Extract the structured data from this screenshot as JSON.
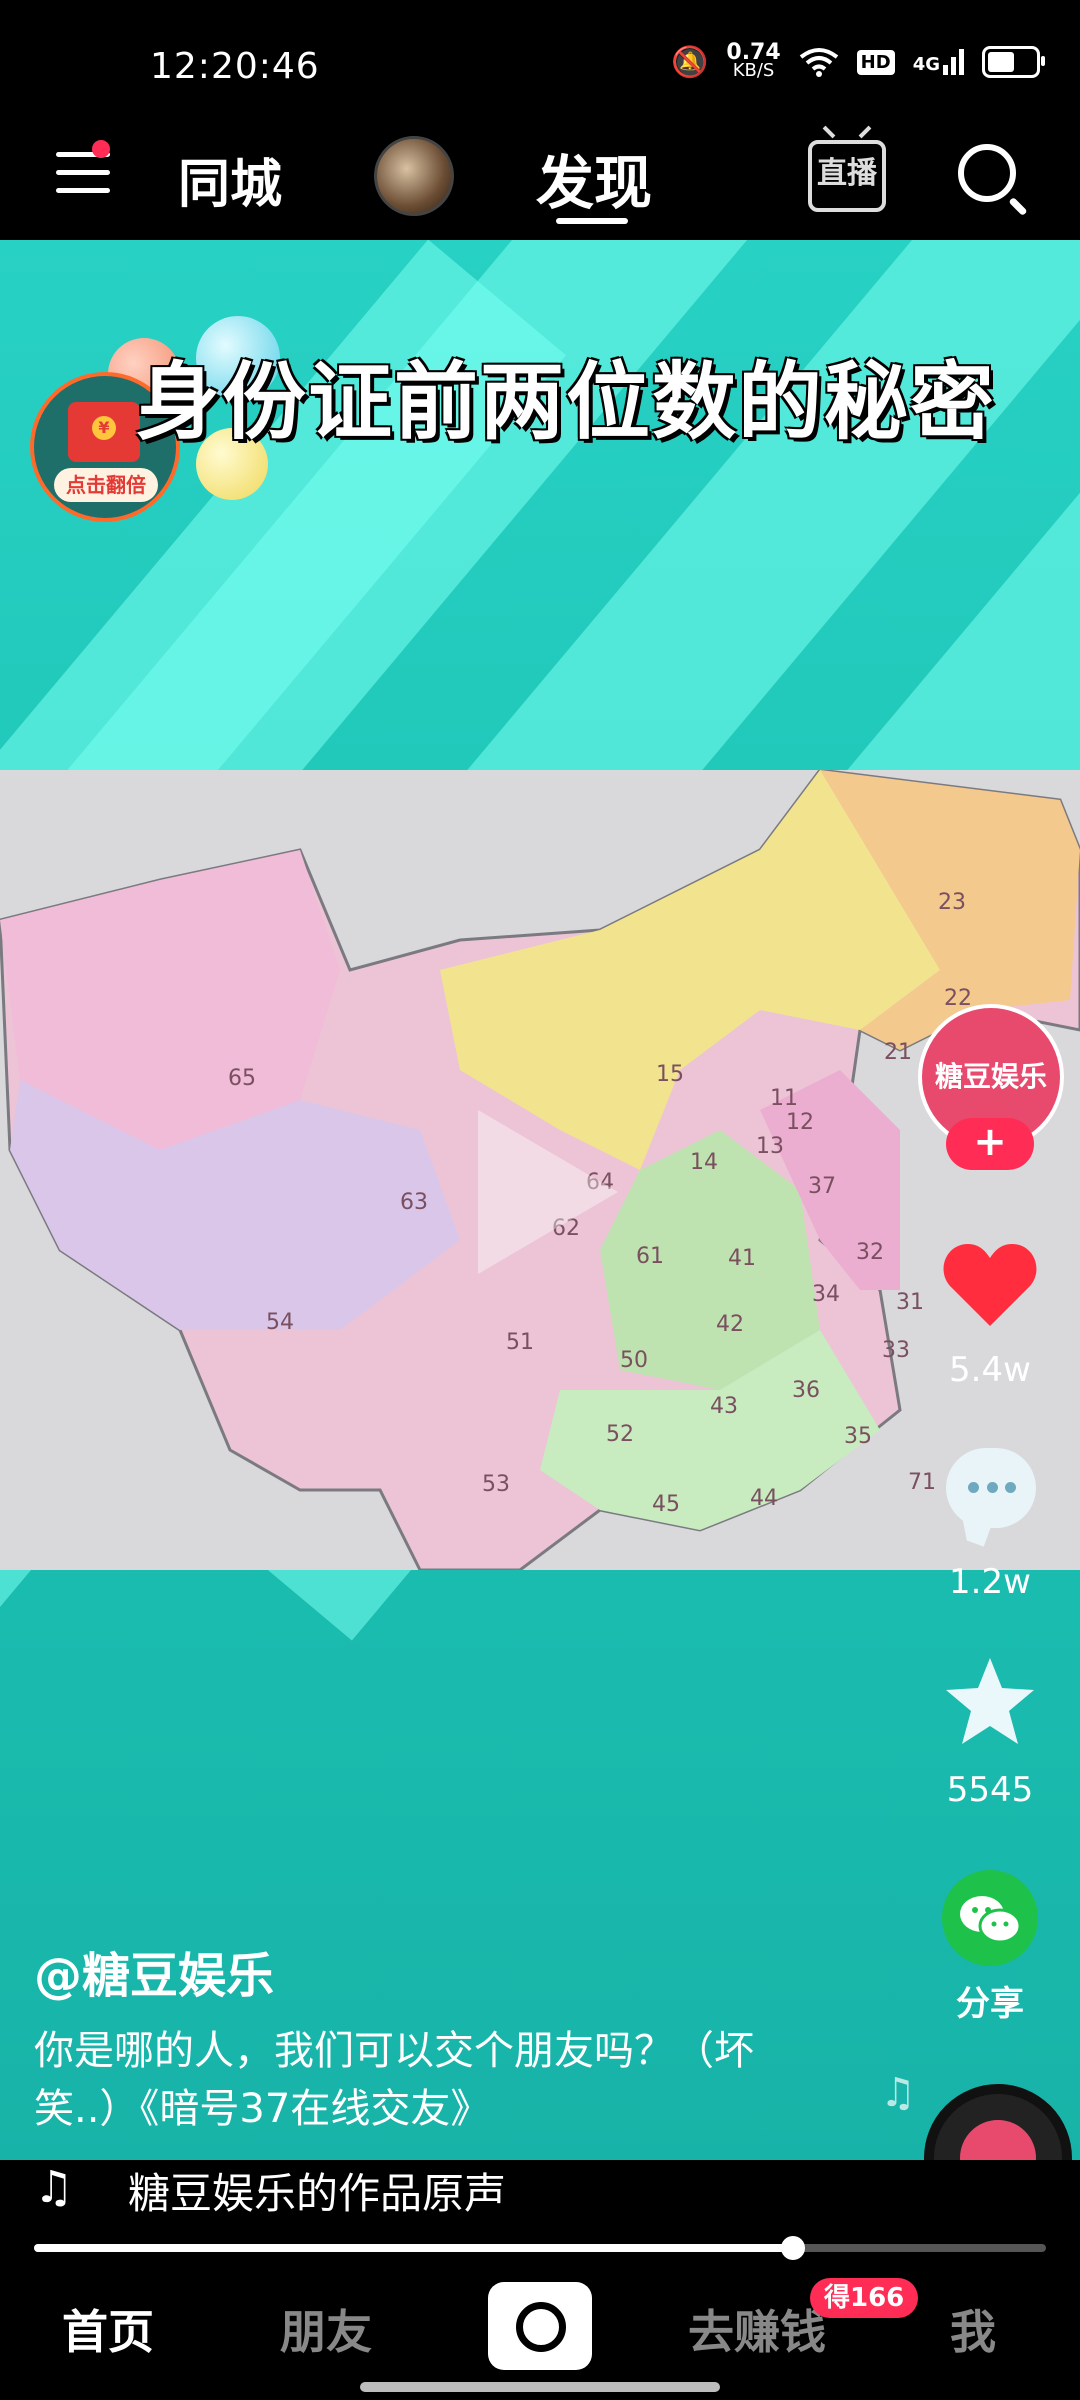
{
  "status_bar": {
    "time": "12:20:46",
    "speed_value": "0.74",
    "speed_unit": "KB/S",
    "hd": "HD",
    "network": "4G"
  },
  "top_nav": {
    "tab_local": "同城",
    "tab_discover": "发现",
    "live_label": "直播"
  },
  "video": {
    "title": "身份证前两位数的秘密",
    "redpacket_label": "点击翻倍",
    "map_codes": [
      "65",
      "63",
      "54",
      "64",
      "62",
      "51",
      "15",
      "61",
      "50",
      "53",
      "52",
      "45",
      "44",
      "43",
      "42",
      "41",
      "36",
      "35",
      "34",
      "33",
      "37",
      "32",
      "31",
      "14",
      "13",
      "11",
      "12",
      "21",
      "22",
      "23",
      "71"
    ]
  },
  "creator": {
    "avatar_text": "糖豆娱乐",
    "follow": "+"
  },
  "actions": {
    "likes": "5.4w",
    "comments": "1.2w",
    "favorites": "5545",
    "share": "分享"
  },
  "post": {
    "author": "@糖豆娱乐",
    "description": "你是哪的人，我们可以交个朋友吗？（坏笑..）《暗号37在线交友》"
  },
  "music": {
    "title": "糖豆娱乐的作品原声",
    "progress": 0.75
  },
  "bottom_nav": {
    "home": "首页",
    "friends": "朋友",
    "earn": "去赚钱",
    "earn_badge": "得166",
    "me": "我"
  },
  "colors": {
    "accent": "#ff2d55",
    "video_bg": "#1fc6b8"
  }
}
